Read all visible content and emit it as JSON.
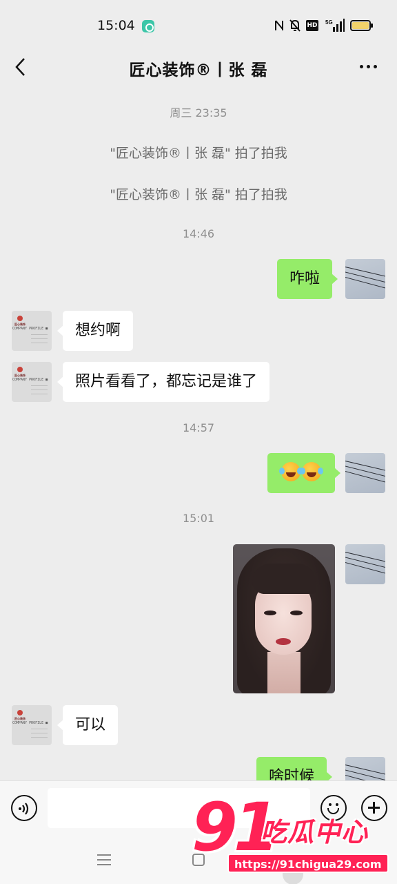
{
  "status_bar": {
    "time": "15:04",
    "hd_label": "HD",
    "network_label": "5G"
  },
  "header": {
    "title": "匠心装饰®丨张 磊"
  },
  "messages": {
    "ts1": "周三 23:35",
    "sys1": "\"匠心装饰®丨张 磊\" 拍了拍我",
    "sys2": "\"匠心装饰®丨张 磊\" 拍了拍我",
    "ts2": "14:46",
    "m1": "咋啦",
    "m2": "想约啊",
    "m3": "照片看看了，都忘记是谁了",
    "ts3": "14:57",
    "ts4": "15:01",
    "m5": "可以",
    "m6": "啥时候"
  },
  "avatar_other": {
    "logo_text": "匠心装饰",
    "caption": "COMPANY PROFILE ■"
  },
  "input": {
    "value": ""
  },
  "watermark": {
    "number": "91",
    "name": "吃瓜中心",
    "url": "https://91chigua29.com"
  },
  "colors": {
    "self_bubble": "#95ec69",
    "other_bubble": "#ffffff",
    "background": "#ededed",
    "watermark": "#ff2255"
  },
  "icons": [
    "back-arrow-icon",
    "more-icon",
    "voice-icon",
    "emoji-icon",
    "plus-icon",
    "nfc-icon",
    "bell-mute-icon",
    "signal-icon",
    "battery-icon",
    "laugh-cry-emoji"
  ]
}
